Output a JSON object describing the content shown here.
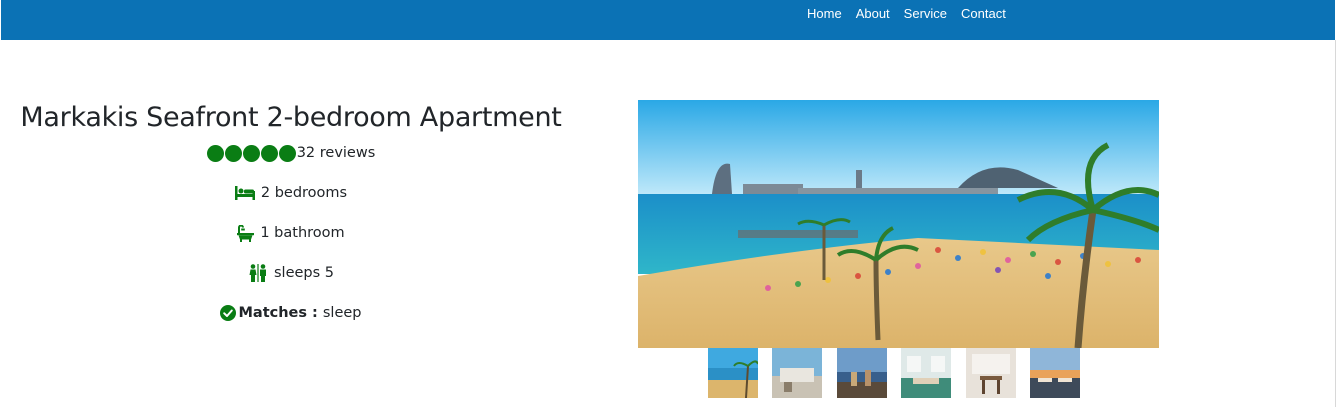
{
  "nav": {
    "items": [
      {
        "label": "Home"
      },
      {
        "label": "About"
      },
      {
        "label": "Service"
      },
      {
        "label": "Contact"
      }
    ]
  },
  "listing": {
    "title": "Markakis Seafront 2-bedroom Apartment",
    "rating_dots": 5,
    "reviews": "32 reviews",
    "bedrooms": "2 bedrooms",
    "bathrooms": "1 bathroom",
    "sleeps": "sleeps 5",
    "matches_label": "Matches :",
    "matches_value": "sleep"
  },
  "icons": {
    "bed": "bed-icon",
    "bath": "bath-icon",
    "people": "people-icon",
    "check": "check-circle-icon"
  },
  "gallery": {
    "thumbnails": 6
  },
  "colors": {
    "navbar": "#0b72b5",
    "accent_green": "#0a7d14"
  }
}
